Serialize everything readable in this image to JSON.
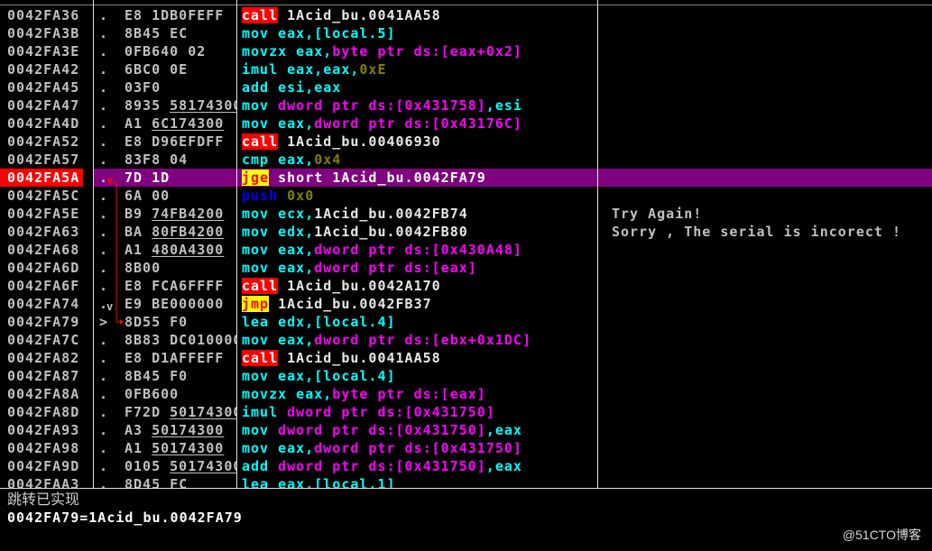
{
  "colors": {
    "background": "#000000",
    "text": "#c0c0c0",
    "symbol": "#e8e8e8",
    "mnemonic": "#00ffff",
    "memory_operand": "#ff00ff",
    "immediate": "#808000",
    "push": "#0000ff",
    "call_bg": "#ff0000",
    "call_fg": "#ffffff",
    "jump_bg": "#ffff00",
    "jump_fg": "#ff0000",
    "selected_row": "#800080",
    "selected_address": "#ff0000",
    "jump_arrow": "#ff0000",
    "divider": "#e0e0e0"
  },
  "disasm": {
    "rows": [
      {
        "addr": "0042FA36",
        "mark": ".",
        "bytes": [
          "E8",
          "1DB0FEFF"
        ],
        "instr": [
          {
            "call": "call"
          },
          {
            "sym": " 1Acid_bu.0041AA58"
          }
        ]
      },
      {
        "addr": "0042FA3B",
        "mark": ".",
        "bytes": [
          "8B45",
          "EC"
        ],
        "instr": [
          {
            "op": "mov"
          },
          {
            "op": " eax,[local.5]"
          }
        ]
      },
      {
        "addr": "0042FA3E",
        "mark": ".",
        "bytes": [
          "0FB640",
          "02"
        ],
        "instr": [
          {
            "op": "movzx"
          },
          {
            "op": " eax,"
          },
          {
            "mem": "byte ptr ds:[eax+0x2]"
          }
        ]
      },
      {
        "addr": "0042FA42",
        "mark": ".",
        "bytes": [
          "6BC0",
          "0E"
        ],
        "instr": [
          {
            "op": "imul"
          },
          {
            "op": " eax,eax,"
          },
          {
            "imm": "0xE"
          }
        ]
      },
      {
        "addr": "0042FA45",
        "mark": ".",
        "bytes": [
          "03F0"
        ],
        "instr": [
          {
            "op": "add"
          },
          {
            "op": " esi,eax"
          }
        ]
      },
      {
        "addr": "0042FA47",
        "mark": ".",
        "bytes": [
          "8935",
          "58174300"
        ],
        "fixup": true,
        "instr": [
          {
            "op": "mov"
          },
          {
            "mem": " dword ptr ds:[0x431758]"
          },
          {
            "op": ",esi"
          }
        ]
      },
      {
        "addr": "0042FA4D",
        "mark": ".",
        "bytes": [
          "A1",
          "6C174300"
        ],
        "fixup": true,
        "instr": [
          {
            "op": "mov"
          },
          {
            "op": " eax,"
          },
          {
            "mem": "dword ptr ds:[0x43176C]"
          }
        ]
      },
      {
        "addr": "0042FA52",
        "mark": ".",
        "bytes": [
          "E8",
          "D96EFDFF"
        ],
        "instr": [
          {
            "call": "call"
          },
          {
            "sym": " 1Acid_bu.00406930"
          }
        ]
      },
      {
        "addr": "0042FA57",
        "mark": ".",
        "bytes": [
          "83F8",
          "04"
        ],
        "instr": [
          {
            "op": "cmp"
          },
          {
            "op": " eax,"
          },
          {
            "imm": "0x4"
          }
        ]
      },
      {
        "addr": "0042FA5A",
        "mark": ".",
        "jump_mark": "v",
        "selected": true,
        "jump_source": true,
        "bytes": [
          "7D",
          "1D"
        ],
        "instr": [
          {
            "jcc": "jge"
          },
          {
            "sym": " short 1Acid_bu.0042FA79"
          }
        ]
      },
      {
        "addr": "0042FA5C",
        "mark": ".",
        "bytes": [
          "6A",
          "00"
        ],
        "instr": [
          {
            "push": "push"
          },
          {
            "imm": " 0x0"
          }
        ]
      },
      {
        "addr": "0042FA5E",
        "mark": ".",
        "bytes": [
          "B9",
          "74FB4200"
        ],
        "fixup": true,
        "instr": [
          {
            "op": "mov"
          },
          {
            "op": " ecx,"
          },
          {
            "sym": "1Acid_bu.0042FB74"
          }
        ],
        "comment": "Try Again!"
      },
      {
        "addr": "0042FA63",
        "mark": ".",
        "bytes": [
          "BA",
          "80FB4200"
        ],
        "fixup": true,
        "instr": [
          {
            "op": "mov"
          },
          {
            "op": " edx,"
          },
          {
            "sym": "1Acid_bu.0042FB80"
          }
        ],
        "comment": "Sorry , The serial is incorect !"
      },
      {
        "addr": "0042FA68",
        "mark": ".",
        "bytes": [
          "A1",
          "480A4300"
        ],
        "fixup": true,
        "instr": [
          {
            "op": "mov"
          },
          {
            "op": " eax,"
          },
          {
            "mem": "dword ptr ds:[0x430A48]"
          }
        ]
      },
      {
        "addr": "0042FA6D",
        "mark": ".",
        "bytes": [
          "8B00"
        ],
        "instr": [
          {
            "op": "mov"
          },
          {
            "op": " eax,"
          },
          {
            "mem": "dword ptr ds:[eax]"
          }
        ]
      },
      {
        "addr": "0042FA6F",
        "mark": ".",
        "bytes": [
          "E8",
          "FCA6FFFF"
        ],
        "instr": [
          {
            "call": "call"
          },
          {
            "sym": " 1Acid_bu.0042A170"
          }
        ]
      },
      {
        "addr": "0042FA74",
        "mark": ".",
        "jump_mark": "v",
        "bytes": [
          "E9",
          "BE000000"
        ],
        "instr": [
          {
            "jcc": "jmp"
          },
          {
            "sym": " 1Acid_bu.0042FB37"
          }
        ]
      },
      {
        "addr": "0042FA79",
        "mark": ">",
        "jump_target": true,
        "bytes": [
          "8D55",
          "F0"
        ],
        "instr": [
          {
            "op": "lea"
          },
          {
            "op": " edx,[local.4]"
          }
        ]
      },
      {
        "addr": "0042FA7C",
        "mark": ".",
        "bytes": [
          "8B83",
          "DC010000"
        ],
        "instr": [
          {
            "op": "mov"
          },
          {
            "op": " eax,"
          },
          {
            "mem": "dword ptr ds:[ebx+0x1DC]"
          }
        ]
      },
      {
        "addr": "0042FA82",
        "mark": ".",
        "bytes": [
          "E8",
          "D1AFFEFF"
        ],
        "instr": [
          {
            "call": "call"
          },
          {
            "sym": " 1Acid_bu.0041AA58"
          }
        ]
      },
      {
        "addr": "0042FA87",
        "mark": ".",
        "bytes": [
          "8B45",
          "F0"
        ],
        "instr": [
          {
            "op": "mov"
          },
          {
            "op": " eax,[local.4]"
          }
        ]
      },
      {
        "addr": "0042FA8A",
        "mark": ".",
        "bytes": [
          "0FB600"
        ],
        "instr": [
          {
            "op": "movzx"
          },
          {
            "op": " eax,"
          },
          {
            "mem": "byte ptr ds:[eax]"
          }
        ]
      },
      {
        "addr": "0042FA8D",
        "mark": ".",
        "bytes": [
          "F72D",
          "50174300"
        ],
        "fixup": true,
        "instr": [
          {
            "op": "imul"
          },
          {
            "mem": " dword ptr ds:[0x431750]"
          }
        ]
      },
      {
        "addr": "0042FA93",
        "mark": ".",
        "bytes": [
          "A3",
          "50174300"
        ],
        "fixup": true,
        "instr": [
          {
            "op": "mov"
          },
          {
            "mem": " dword ptr ds:[0x431750]"
          },
          {
            "op": ",eax"
          }
        ]
      },
      {
        "addr": "0042FA98",
        "mark": ".",
        "bytes": [
          "A1",
          "50174300"
        ],
        "fixup": true,
        "instr": [
          {
            "op": "mov"
          },
          {
            "op": " eax,"
          },
          {
            "mem": "dword ptr ds:[0x431750]"
          }
        ]
      },
      {
        "addr": "0042FA9D",
        "mark": ".",
        "bytes": [
          "0105",
          "50174300"
        ],
        "fixup": true,
        "instr": [
          {
            "op": "add"
          },
          {
            "mem": " dword ptr ds:[0x431750]"
          },
          {
            "op": ",eax"
          }
        ]
      },
      {
        "addr": "0042FAA3",
        "mark": ".",
        "bytes": [
          "8D45",
          "FC"
        ],
        "instr": [
          {
            "op": "lea"
          },
          {
            "op": " eax,[local.1]"
          }
        ]
      }
    ]
  },
  "info_panel": {
    "status": "跳转已实现",
    "target": "0042FA79=1Acid_bu.0042FA79"
  },
  "watermark": "@51CTO博客"
}
